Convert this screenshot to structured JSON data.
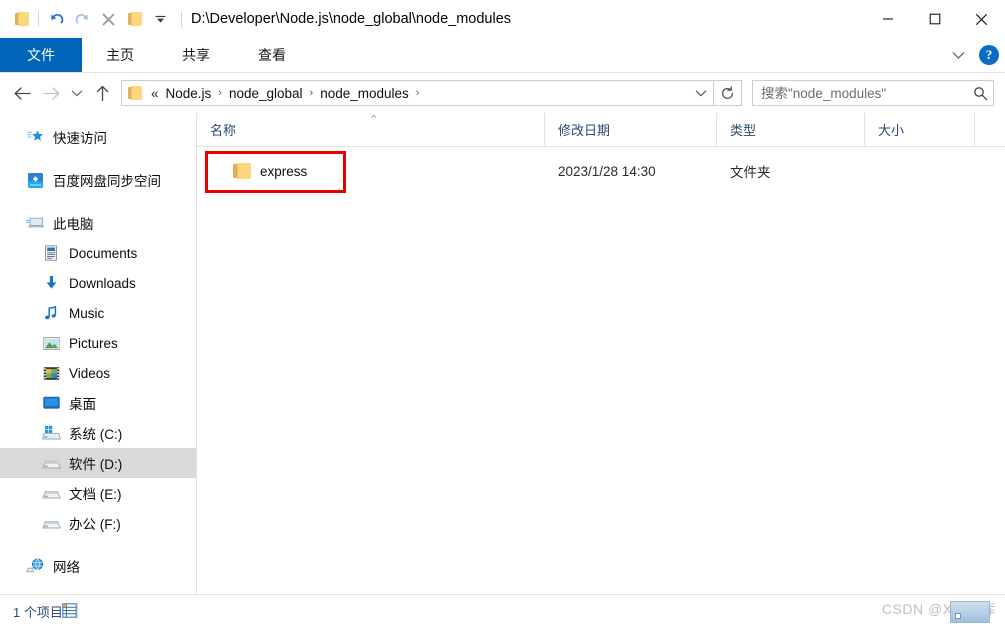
{
  "window": {
    "title": "D:\\Developer\\Node.js\\node_global\\node_modules"
  },
  "quick_access_toolbar": {
    "items": [
      {
        "name": "properties-folder-icon",
        "label": ""
      },
      {
        "name": "undo-icon",
        "label": ""
      },
      {
        "name": "redo-icon",
        "label": ""
      },
      {
        "name": "delete-icon",
        "label": ""
      },
      {
        "name": "new-folder-icon",
        "label": ""
      },
      {
        "name": "customize-dropdown-icon",
        "label": ""
      }
    ]
  },
  "window_controls": {
    "minimize": "─",
    "maximize": "□",
    "close": "✕"
  },
  "ribbon": {
    "tabs": [
      {
        "label": "文件",
        "active": true
      },
      {
        "label": "主页",
        "active": false
      },
      {
        "label": "共享",
        "active": false
      },
      {
        "label": "查看",
        "active": false
      }
    ],
    "collapse_label": "⌄",
    "help_label": "?"
  },
  "navigation": {
    "back_label": "←",
    "forward_label": "→",
    "recent_label": "⌄",
    "up_label": "↑"
  },
  "address_bar": {
    "ellipsis": "«",
    "crumbs": [
      {
        "label": "Node.js"
      },
      {
        "label": "node_global"
      },
      {
        "label": "node_modules"
      }
    ],
    "separator": "›",
    "dropdown_label": "⌄",
    "refresh_label": "↻"
  },
  "search": {
    "placeholder": "搜索\"node_modules\"",
    "value": "",
    "icon": "search-icon"
  },
  "sidebar": {
    "items": [
      {
        "label": "快速访问",
        "icon": "quick-access-star-icon",
        "level": 0,
        "selected": false,
        "gap_after": true
      },
      {
        "label": "百度网盘同步空间",
        "icon": "baidu-netdisk-icon",
        "level": 0,
        "selected": false,
        "gap_after": true
      },
      {
        "label": "此电脑",
        "icon": "this-pc-icon",
        "level": 0,
        "selected": false,
        "gap_after": false
      },
      {
        "label": "Documents",
        "icon": "documents-icon",
        "level": 1,
        "selected": false,
        "gap_after": false
      },
      {
        "label": "Downloads",
        "icon": "downloads-icon",
        "level": 1,
        "selected": false,
        "gap_after": false
      },
      {
        "label": "Music",
        "icon": "music-icon",
        "level": 1,
        "selected": false,
        "gap_after": false
      },
      {
        "label": "Pictures",
        "icon": "pictures-icon",
        "level": 1,
        "selected": false,
        "gap_after": false
      },
      {
        "label": "Videos",
        "icon": "videos-icon",
        "level": 1,
        "selected": false,
        "gap_after": false
      },
      {
        "label": "桌面",
        "icon": "desktop-icon",
        "level": 1,
        "selected": false,
        "gap_after": false
      },
      {
        "label": "系统 (C:)",
        "icon": "system-drive-icon",
        "level": 1,
        "selected": false,
        "gap_after": false
      },
      {
        "label": "软件 (D:)",
        "icon": "drive-icon",
        "level": 1,
        "selected": true,
        "gap_after": false
      },
      {
        "label": "文档 (E:)",
        "icon": "drive-icon",
        "level": 1,
        "selected": false,
        "gap_after": false
      },
      {
        "label": "办公 (F:)",
        "icon": "drive-icon",
        "level": 1,
        "selected": false,
        "gap_after": true
      },
      {
        "label": "网络",
        "icon": "network-icon",
        "level": 0,
        "selected": false,
        "gap_after": false
      }
    ]
  },
  "file_list": {
    "columns": [
      {
        "key": "name",
        "label": "名称",
        "sorted": "asc"
      },
      {
        "key": "date",
        "label": "修改日期",
        "sorted": ""
      },
      {
        "key": "type",
        "label": "类型",
        "sorted": ""
      },
      {
        "key": "size",
        "label": "大小",
        "sorted": ""
      }
    ],
    "sort_indicator": "⌃",
    "rows": [
      {
        "name": "express",
        "date": "2023/1/28 14:30",
        "type": "文件夹",
        "size": "",
        "icon": "folder-icon",
        "highlighted": true
      }
    ]
  },
  "status_bar": {
    "item_count": "1 个项目",
    "view_icon": "details-view-icon"
  },
  "watermark": {
    "text": "CSDN @X档案库"
  },
  "colors": {
    "accent": "#0065b8",
    "header_text": "#2b4a73",
    "annotation_red": "#e60000",
    "folder_yellow": "#fbd77e",
    "selection_gray": "#d9d9d9"
  }
}
